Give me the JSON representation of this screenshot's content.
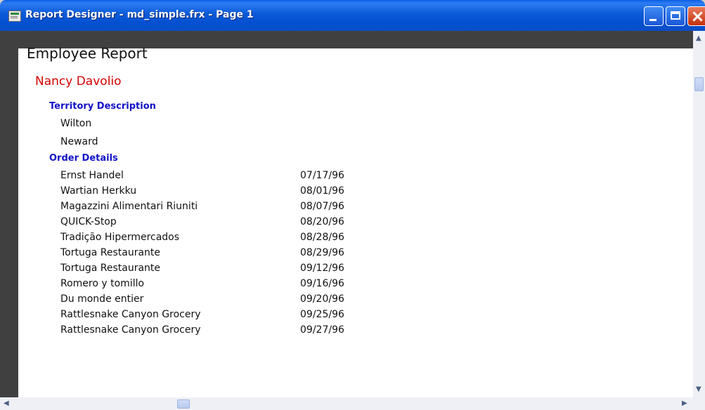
{
  "window": {
    "title": "Report Designer - md_simple.frx - Page 1"
  },
  "report": {
    "title": "Employee Report",
    "employee_name": "Nancy Davolio",
    "territory_header": "Territory Description",
    "territories": [
      "Wilton",
      "Neward"
    ],
    "orders_header": "Order Details",
    "orders": [
      {
        "company": "Ernst Handel",
        "date": "07/17/96"
      },
      {
        "company": "Wartian Herkku",
        "date": "08/01/96"
      },
      {
        "company": "Magazzini Alimentari Riuniti",
        "date": "08/07/96"
      },
      {
        "company": "QUICK-Stop",
        "date": "08/20/96"
      },
      {
        "company": "Tradição Hipermercados",
        "date": "08/28/96"
      },
      {
        "company": "Tortuga Restaurante",
        "date": "08/29/96"
      },
      {
        "company": "Tortuga Restaurante",
        "date": "09/12/96"
      },
      {
        "company": "Romero y tomillo",
        "date": "09/16/96"
      },
      {
        "company": "Du monde entier",
        "date": "09/20/96"
      },
      {
        "company": "Rattlesnake Canyon Grocery",
        "date": "09/25/96"
      },
      {
        "company": "Rattlesnake Canyon Grocery",
        "date": "09/27/96"
      }
    ]
  },
  "colors": {
    "titlebar": "#0a5fe4",
    "employee_name": "#d40000",
    "section_header": "#1212c8",
    "preview_background": "#404040"
  },
  "icons": [
    "app-icon",
    "minimize-icon",
    "maximize-icon",
    "close-icon",
    "scroll-up-icon",
    "scroll-down-icon",
    "scroll-left-icon",
    "scroll-right-icon"
  ]
}
